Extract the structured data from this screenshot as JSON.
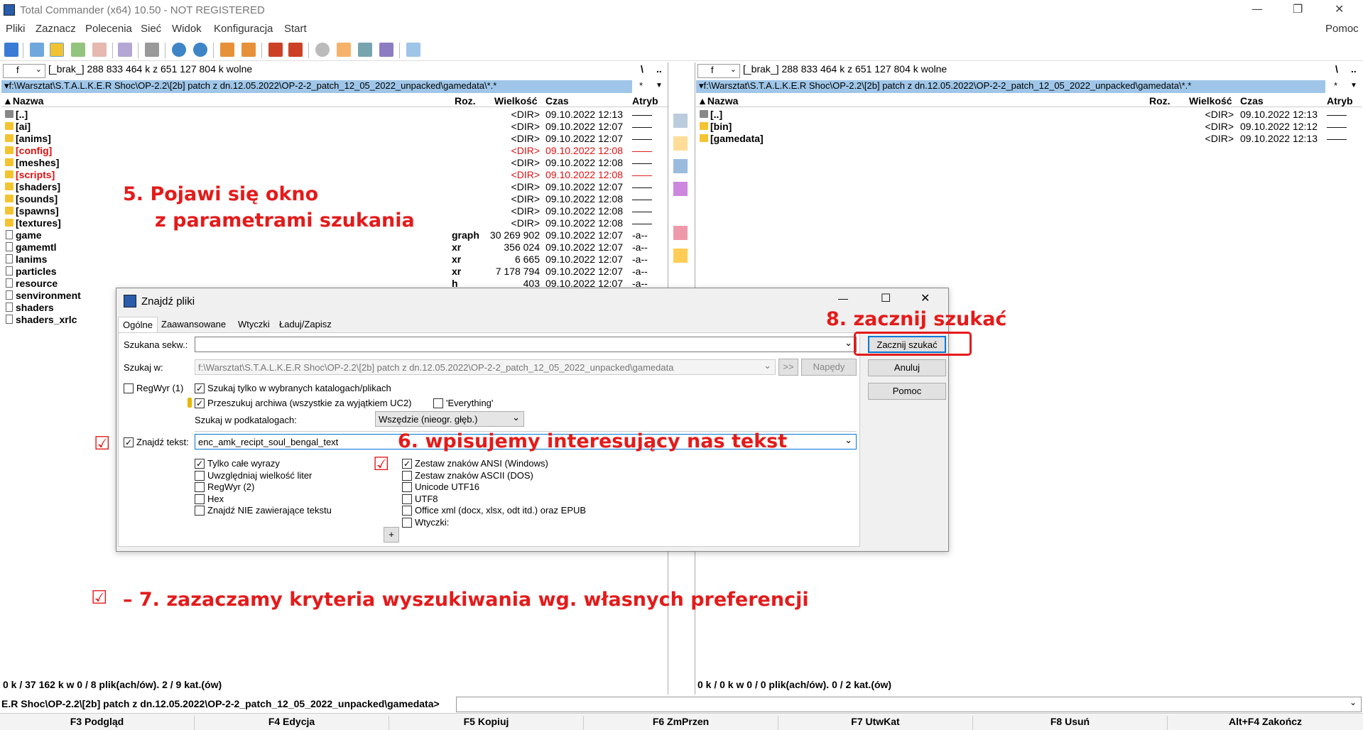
{
  "window": {
    "title": "Total Commander (x64) 10.50 - NOT REGISTERED",
    "minimize": "—",
    "maximize": "❐",
    "close": "✕"
  },
  "menu": {
    "items": [
      "Pliki",
      "Zaznacz",
      "Polecenia",
      "Sieć",
      "Widok",
      "Konfiguracja",
      "Start"
    ],
    "help": "Pomoc"
  },
  "left": {
    "drive": "f",
    "driveinfo": "[_brak_]  288 833 464 k z 651 127 804 k wolne",
    "root": "\\",
    "up": "..",
    "path": "▾f:\\Warsztat\\S.T.A.L.K.E.R Shoc\\OP-2.2\\[2b] patch z dn.12.05.2022\\OP-2-2_patch_12_05_2022_unpacked\\gamedata\\*.*",
    "path_star": "*",
    "path_arrow": "▼",
    "cols": {
      "name": "▲Nazwa",
      "ext": "Roz.",
      "size": "Wielkość",
      "time": "Czas",
      "attr": "Atryb"
    },
    "status": "0 k / 37 162 k w 0 / 8 plik(ach/ów). 2 / 9 kat.(ów)"
  },
  "right": {
    "drive": "f",
    "driveinfo": "[_brak_]  288 833 464 k z 651 127 804 k wolne",
    "root": "\\",
    "up": "..",
    "path": "▾f:\\Warsztat\\S.T.A.L.K.E.R Shoc\\OP-2.2\\[2b] patch z dn.12.05.2022\\OP-2-2_patch_12_05_2022_unpacked\\gamedata\\*.*",
    "path_star": "*",
    "path_arrow": "▼",
    "cols": {
      "name": "▲Nazwa",
      "ext": "Roz.",
      "size": "Wielkość",
      "time": "Czas",
      "attr": "Atryb"
    },
    "status": "0 k / 0 k w 0 / 0 plik(ach/ów). 0 / 2 kat.(ów)"
  },
  "left_files": [
    {
      "name": "[..]",
      "ext": "",
      "size": "<DIR>",
      "time": "09.10.2022 12:13",
      "attr": "——",
      "red": false,
      "type": "up"
    },
    {
      "name": "[ai]",
      "ext": "",
      "size": "<DIR>",
      "time": "09.10.2022 12:07",
      "attr": "——",
      "red": false,
      "type": "dir"
    },
    {
      "name": "[anims]",
      "ext": "",
      "size": "<DIR>",
      "time": "09.10.2022 12:07",
      "attr": "——",
      "red": false,
      "type": "dir"
    },
    {
      "name": "[config]",
      "ext": "",
      "size": "<DIR>",
      "time": "09.10.2022 12:08",
      "attr": "——",
      "red": true,
      "type": "dir"
    },
    {
      "name": "[meshes]",
      "ext": "",
      "size": "<DIR>",
      "time": "09.10.2022 12:08",
      "attr": "——",
      "red": false,
      "type": "dir"
    },
    {
      "name": "[scripts]",
      "ext": "",
      "size": "<DIR>",
      "time": "09.10.2022 12:08",
      "attr": "——",
      "red": true,
      "type": "dir"
    },
    {
      "name": "[shaders]",
      "ext": "",
      "size": "<DIR>",
      "time": "09.10.2022 12:07",
      "attr": "——",
      "red": false,
      "type": "dir"
    },
    {
      "name": "[sounds]",
      "ext": "",
      "size": "<DIR>",
      "time": "09.10.2022 12:08",
      "attr": "——",
      "red": false,
      "type": "dir"
    },
    {
      "name": "[spawns]",
      "ext": "",
      "size": "<DIR>",
      "time": "09.10.2022 12:08",
      "attr": "——",
      "red": false,
      "type": "dir"
    },
    {
      "name": "[textures]",
      "ext": "",
      "size": "<DIR>",
      "time": "09.10.2022 12:08",
      "attr": "——",
      "red": false,
      "type": "dir"
    },
    {
      "name": "game",
      "ext": "graph",
      "size": "30 269 902",
      "time": "09.10.2022 12:07",
      "attr": "-a--",
      "red": false,
      "type": "file"
    },
    {
      "name": "gamemtl",
      "ext": "xr",
      "size": "356 024",
      "time": "09.10.2022 12:07",
      "attr": "-a--",
      "red": false,
      "type": "file"
    },
    {
      "name": "lanims",
      "ext": "xr",
      "size": "6 665",
      "time": "09.10.2022 12:07",
      "attr": "-a--",
      "red": false,
      "type": "file"
    },
    {
      "name": "particles",
      "ext": "xr",
      "size": "7 178 794",
      "time": "09.10.2022 12:07",
      "attr": "-a--",
      "red": false,
      "type": "file"
    },
    {
      "name": "resource",
      "ext": "h",
      "size": "403",
      "time": "09.10.2022 12:07",
      "attr": "-a--",
      "red": false,
      "type": "file"
    },
    {
      "name": "senvironment",
      "ext": "",
      "size": "",
      "time": "",
      "attr": "",
      "red": false,
      "type": "file"
    },
    {
      "name": "shaders",
      "ext": "",
      "size": "",
      "time": "",
      "attr": "",
      "red": false,
      "type": "file"
    },
    {
      "name": "shaders_xrlc",
      "ext": "",
      "size": "",
      "time": "",
      "attr": "",
      "red": false,
      "type": "file"
    }
  ],
  "right_files": [
    {
      "name": "[..]",
      "ext": "",
      "size": "<DIR>",
      "time": "09.10.2022 12:13",
      "attr": "——",
      "red": false,
      "type": "up"
    },
    {
      "name": "[bin]",
      "ext": "",
      "size": "<DIR>",
      "time": "09.10.2022 12:12",
      "attr": "——",
      "red": false,
      "type": "dir"
    },
    {
      "name": "[gamedata]",
      "ext": "",
      "size": "<DIR>",
      "time": "09.10.2022 12:13",
      "attr": "——",
      "red": false,
      "type": "dir"
    }
  ],
  "cmdline": {
    "path": "E.R Shoc\\OP-2.2\\[2b] patch z dn.12.05.2022\\OP-2-2_patch_12_05_2022_unpacked\\gamedata>",
    "arrow": "⌄"
  },
  "fkeys": [
    "F3 Podgląd",
    "F4 Edycja",
    "F5 Kopiuj",
    "F6 ZmPrzen",
    "F7 UtwKat",
    "F8 Usuń",
    "Alt+F4 Zakończ"
  ],
  "dialog": {
    "title": "Znajdź pliki",
    "tabs": [
      "Ogólne",
      "Zaawansowane",
      "Wtyczki",
      "Ładuj/Zapisz"
    ],
    "search_label": "Szukana sekw.:",
    "search_value": "",
    "searchin_label": "Szukaj w:",
    "searchin_value": "f:\\Warsztat\\S.T.A.L.K.E.R Shoc\\OP-2.2\\[2b] patch z dn.12.05.2022\\OP-2-2_patch_12_05_2022_unpacked\\gamedata",
    "browse": ">>",
    "drives": "Napędy",
    "regex1": "RegWyr (1)",
    "only_selected": "Szukaj tylko w wybranych katalogach/plikach",
    "archives": "Przeszukuj archiwa (wszystkie za wyjątkiem UC2)",
    "everything": "'Everything'",
    "subdirs_label": "Szukaj w podkatalogach:",
    "subdirs_value": "Wszędzie (nieogr. głęb.)",
    "findtext_label": "Znajdź tekst:",
    "findtext_value": "enc_amk_recipt_soul_bengal_text",
    "opts_left": [
      "Tylko całe wyrazy",
      "Uwzględniaj wielkość liter",
      "RegWyr (2)",
      "Hex",
      "Znajdź NIE zawierające tekstu"
    ],
    "opts_left_checked": [
      true,
      false,
      false,
      false,
      false
    ],
    "opts_right": [
      "Zestaw znaków ANSI (Windows)",
      "Zestaw znaków ASCII (DOS)",
      "Unicode UTF16",
      "UTF8",
      "Office xml (docx, xlsx, odt itd.) oraz EPUB",
      "Wtyczki:"
    ],
    "opts_right_checked": [
      true,
      false,
      false,
      false,
      false,
      false
    ],
    "plus": "+",
    "btn_start": "Zacznij szukać",
    "btn_cancel": "Anuluj",
    "btn_help": "Pomoc",
    "win_min": "—",
    "win_max": "☐",
    "win_close": "✕"
  },
  "annotations": {
    "a5_line1": "5.  Pojawi się okno",
    "a5_line2": "z parametrami szukania",
    "a6": "6.  wpisujemy interesujący nas tekst",
    "a7": "– 7.  zazaczamy kryteria wyszukiwania wg. własnych preferencji",
    "a8": "8. zacznij szukać",
    "check": "☑"
  },
  "colors": {
    "accent_red": "#e31b1b",
    "path_bar": "#9fc6e8",
    "red_file": "#e01010"
  }
}
